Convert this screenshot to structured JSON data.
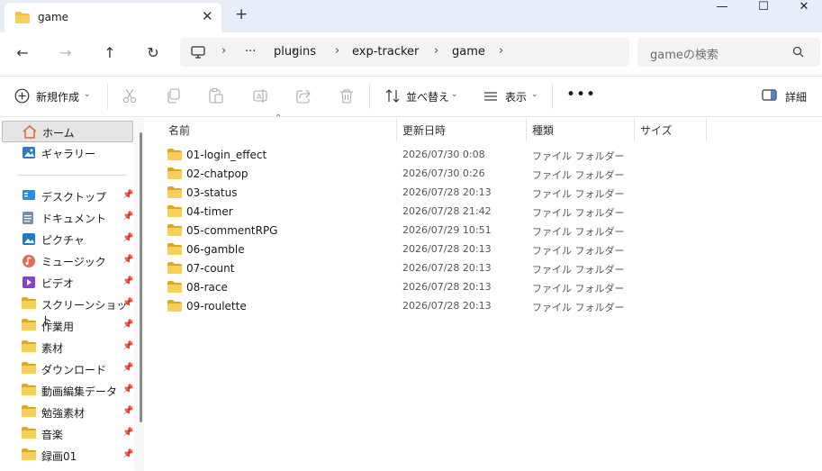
{
  "colors": {
    "titlebar": "#e8eef7",
    "folder": "#f3bf40",
    "folder_dark": "#e0a526",
    "selected": "#e5e5e5"
  },
  "tab": {
    "title": "game",
    "close_glyph": "✕",
    "new_tab_glyph": "+"
  },
  "window": {
    "minimize": "—",
    "maximize": "☐",
    "close": "✕"
  },
  "nav": {
    "back": "←",
    "forward": "→",
    "up": "↑",
    "refresh": "↻"
  },
  "breadcrumb": {
    "overflow": "···",
    "items": [
      "plugins",
      "exp-tracker",
      "game"
    ],
    "separator": "›"
  },
  "search": {
    "placeholder": "gameの検索"
  },
  "toolbar": {
    "new_label": "新規作成",
    "sort_label": "並べ替え",
    "view_label": "表示",
    "more": "•••",
    "details_label": "詳細",
    "icons": [
      "cut-icon",
      "copy-icon",
      "paste-icon",
      "rename-icon",
      "share-icon",
      "delete-icon"
    ]
  },
  "sidebar": {
    "top": [
      {
        "label": "ホーム",
        "icon": "home-icon",
        "selected": true
      },
      {
        "label": "ギャラリー",
        "icon": "gallery-icon"
      }
    ],
    "pinned": [
      {
        "label": "デスクトップ",
        "icon": "desktop-icon"
      },
      {
        "label": "ドキュメント",
        "icon": "documents-icon"
      },
      {
        "label": "ピクチャ",
        "icon": "pictures-icon"
      },
      {
        "label": "ミュージック",
        "icon": "music-icon"
      },
      {
        "label": "ビデオ",
        "icon": "videos-icon"
      },
      {
        "label": "スクリーンショット",
        "icon": "folder-icon"
      },
      {
        "label": "作業用",
        "icon": "folder-icon"
      },
      {
        "label": "素材",
        "icon": "folder-icon"
      },
      {
        "label": "ダウンロード",
        "icon": "folder-icon"
      },
      {
        "label": "動画編集データ",
        "icon": "folder-icon"
      },
      {
        "label": "勉強素材",
        "icon": "folder-icon"
      },
      {
        "label": "音楽",
        "icon": "folder-icon"
      },
      {
        "label": "録画01",
        "icon": "folder-icon"
      }
    ]
  },
  "columns": {
    "name": "名前",
    "modified": "更新日時",
    "type": "種類",
    "size": "サイズ"
  },
  "files": [
    {
      "name": "01-login_effect",
      "modified": "2026/07/30 0:08",
      "type": "ファイル フォルダー"
    },
    {
      "name": "02-chatpop",
      "modified": "2026/07/30 0:26",
      "type": "ファイル フォルダー"
    },
    {
      "name": "03-status",
      "modified": "2026/07/28 20:13",
      "type": "ファイル フォルダー"
    },
    {
      "name": "04-timer",
      "modified": "2026/07/28 21:42",
      "type": "ファイル フォルダー"
    },
    {
      "name": "05-commentRPG",
      "modified": "2026/07/29 10:51",
      "type": "ファイル フォルダー"
    },
    {
      "name": "06-gamble",
      "modified": "2026/07/28 20:13",
      "type": "ファイル フォルダー"
    },
    {
      "name": "07-count",
      "modified": "2026/07/28 20:13",
      "type": "ファイル フォルダー"
    },
    {
      "name": "08-race",
      "modified": "2026/07/28 20:13",
      "type": "ファイル フォルダー"
    },
    {
      "name": "09-roulette",
      "modified": "2026/07/28 20:13",
      "type": "ファイル フォルダー"
    }
  ]
}
